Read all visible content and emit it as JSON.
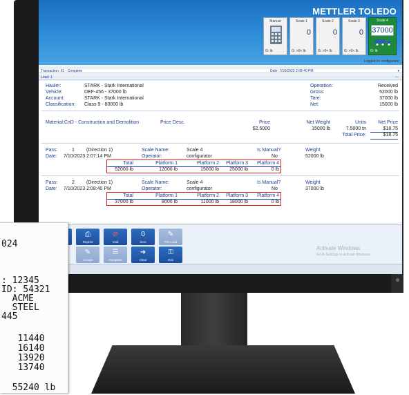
{
  "receipt": {
    "lines": [
      "024",
      "",
      ": 12345",
      "ID: 54321",
      "  ACME",
      "  STEEL",
      "445",
      "",
      "   11440",
      "   16140",
      "   13920",
      "   13740",
      "",
      "  55240 lb"
    ]
  },
  "app": {
    "brand": "METTLER TOLEDO",
    "logged_in": "Logged In: configurator",
    "scales": [
      {
        "name": "Manual",
        "value": "",
        "foot": "G:      lb"
      },
      {
        "name": "Scale 1",
        "value": "0",
        "foot": "G: >0< lb"
      },
      {
        "name": "Scale 2",
        "value": "0",
        "foot": "G: >0< lb"
      },
      {
        "name": "Scale 3",
        "value": "0",
        "foot": "G: >0< lb"
      },
      {
        "name": "Scale 4",
        "value": "37000",
        "foot": "G:          lb"
      }
    ],
    "transaction_label": "Transaction: 61 - Complete",
    "transaction_date": "Date: 7/10/2023 2:08:40 PM",
    "load_label": "Load: 1"
  },
  "hauler_info": {
    "hauler_label": "Hauler:",
    "hauler": "STARK - Stark International",
    "vehicle_label": "Vehicle:",
    "vehicle": "DEF-456 - 37000 lb",
    "account_label": "Account:",
    "account": "STARK - Stark International",
    "class_label": "Classification:",
    "classification": "Class 9 - 80000 lb"
  },
  "operation": {
    "operation_label": "Operation:",
    "operation": "Received",
    "gross_label": "Gross:",
    "gross": "52000 lb",
    "tare_label": "Tare:",
    "tare": "37000 lb",
    "net_label": "Net:",
    "net": "15000 lb"
  },
  "material": {
    "material": "Material:CnD - Construction and Demolition",
    "price_desc": "Price Desc.",
    "headers": {
      "price": "Price",
      "net_weight": "Net Weight",
      "units": "Units",
      "net_price": "Net Price"
    },
    "row": {
      "price": "$2.5000",
      "net_weight": "15000 lb",
      "units": "7.5000 tn",
      "net_price": "$18.75"
    },
    "total_label": "Total Price:",
    "total": "$18.75"
  },
  "passes": [
    {
      "pass_label": "Pass:",
      "pass": "1",
      "direction": "(Direction 1)",
      "date_label": "Date:",
      "date": "7/10/2023 2:07:14 PM",
      "scale_label": "Scale Name:",
      "scale": "Scale 4",
      "operator_label": "Operator:",
      "operator": "configurator",
      "manual_label": "Is Manual?",
      "manual": "No",
      "weight_label": "Weight",
      "weight": "52000 lb",
      "platform_headers": [
        "Total",
        "Platform 1",
        "Platform 2",
        "Platform 3",
        "Platform 4"
      ],
      "platform_values": [
        "52000 lb",
        "12000 lb",
        "15000 lb",
        "25000 lb",
        "0 lb"
      ]
    },
    {
      "pass_label": "Pass:",
      "pass": "2",
      "direction": "(Direction 1)",
      "date_label": "Date:",
      "date": "7/10/2023 2:08:40 PM",
      "scale_label": "Scale Name:",
      "scale": "Scale 4",
      "operator_label": "Operator:",
      "operator": "configurator",
      "manual_label": "Is Manual?",
      "manual": "No",
      "weight_label": "Weight",
      "weight": "37000 lb",
      "platform_headers": [
        "Total",
        "Platform 1",
        "Platform 2",
        "Platform 3",
        "Platform 4"
      ],
      "platform_values": [
        "37000 lb",
        "8000 lb",
        "11000 lb",
        "18000 lb",
        "0 lb"
      ]
    }
  ],
  "toolbar": {
    "row1": [
      {
        "label": "",
        "icon": "search-icon"
      },
      {
        "label": "Reprint",
        "icon": "printer-icon"
      },
      {
        "label": "Void",
        "icon": "void-icon"
      },
      {
        "label": "Zero",
        "icon": "zero-icon"
      },
      {
        "label": "Pre-Load",
        "icon": "preload-icon"
      }
    ],
    "row2": [
      {
        "label": "Accept",
        "icon": "accept-icon"
      },
      {
        "label": "Complete",
        "icon": "complete-icon"
      },
      {
        "label": "Clear",
        "icon": "clear-icon"
      },
      {
        "label": "Exit",
        "icon": "lock-icon"
      }
    ],
    "watermark_title": "Activate Windows",
    "watermark_sub": "Go to Settings to activate Windows."
  },
  "colors": {
    "header_blue": "#2e8ed8",
    "active_scale_green": "#1f8a3a",
    "highlight_red": "#e01e1e",
    "label_blue": "#1b3f8b"
  }
}
